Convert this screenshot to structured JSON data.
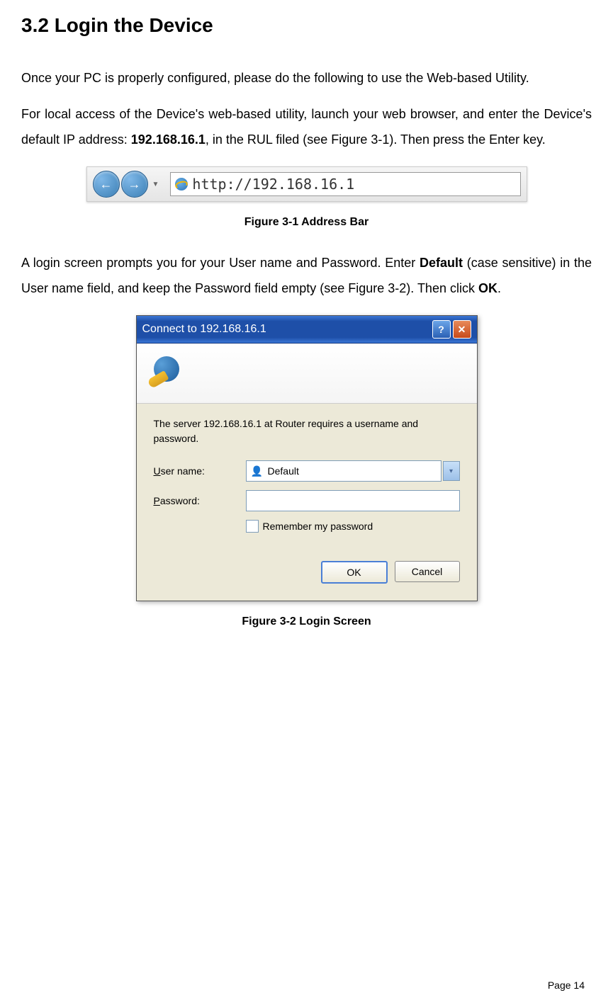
{
  "heading": "3.2    Login the Device",
  "para1": "Once your PC is properly configured, please do the following to use the Web-based Utility.",
  "para2_pre": "For local access of the Device's web-based utility, launch your web browser, and enter the Device's default IP address: ",
  "para2_ip": "192.168.16.1",
  "para2_post": ", in the RUL filed (see Figure 3-1). Then press the Enter key.",
  "caption1": "Figure 3-1 Address Bar",
  "para3_pre": "A login screen prompts you for your User name and Password. Enter ",
  "para3_bold1": "Default",
  "para3_mid": " (case sensitive) in the User name field, and keep the Password field empty (see Figure 3-2). Then click ",
  "para3_bold2": "OK",
  "para3_end": ".",
  "caption2": "Figure 3-2 Login Screen",
  "addressbar": {
    "url": "http://192.168.16.1"
  },
  "dialog": {
    "title": "Connect to 192.168.16.1",
    "message": "The server 192.168.16.1 at Router requires a username and password.",
    "username_label_u": "U",
    "username_label_rest": "ser name:",
    "password_label_u": "P",
    "password_label_rest": "assword:",
    "username_value": "Default",
    "remember_u": "R",
    "remember_rest": "emember my password",
    "ok": "OK",
    "cancel": "Cancel"
  },
  "page_num": "Page  14"
}
